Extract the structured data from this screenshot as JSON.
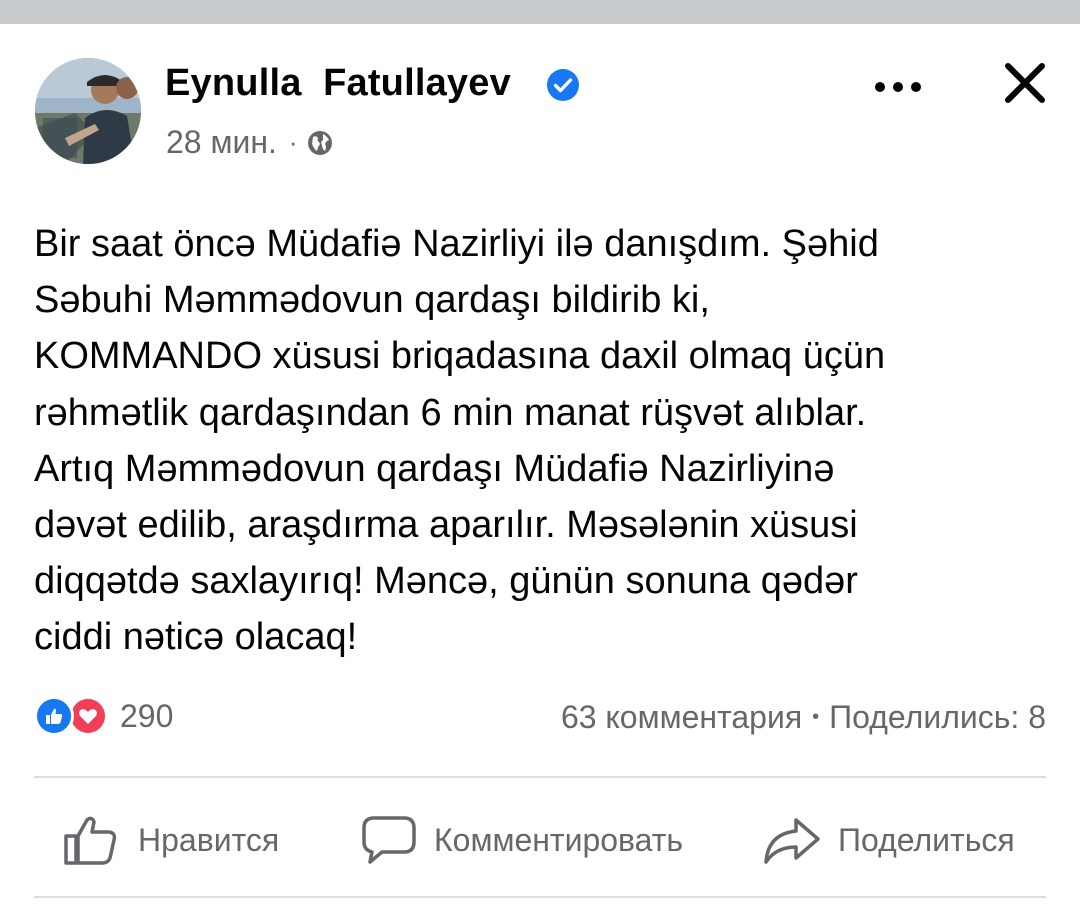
{
  "post": {
    "author_name": "Eynulla  Fatullayev",
    "verified": true,
    "timestamp": "28 мин.",
    "meta_separator": "·",
    "audience_icon": "globe-icon",
    "text": "Bir saat öncə Müdafiə Nazirliyi ilə danışdım. Şəhid\nSəbuhi Məmmədovun qardaşı bildirib ki,\nKOMMANDO xüsusi briqadasına daxil olmaq üçün\nrəhmətlik qardaşından 6 min manat rüşvət alıblar.\nArtıq Məmmədovun qardaşı Müdafiə Nazirliyinə\ndəvət edilib, araşdırma aparılır. Məsələnin xüsusi\ndiqqətdə saxlayırıq! Məncə, günün sonuna qədər\nciddi nəticə olacaq!"
  },
  "stats": {
    "reactions_count": "290",
    "comments": "63 комментария",
    "separator": "•",
    "shares": "Поделились: 8"
  },
  "actions": {
    "like_label": "Нравится",
    "comment_label": "Комментировать",
    "share_label": "Поделиться"
  },
  "colors": {
    "topbar": "#c9cccf",
    "secondary_text": "#65676b",
    "verified_blue": "#1877f2",
    "like_blue": "#1877f2",
    "love_red": "#f33e58",
    "divider": "#dadde1"
  }
}
